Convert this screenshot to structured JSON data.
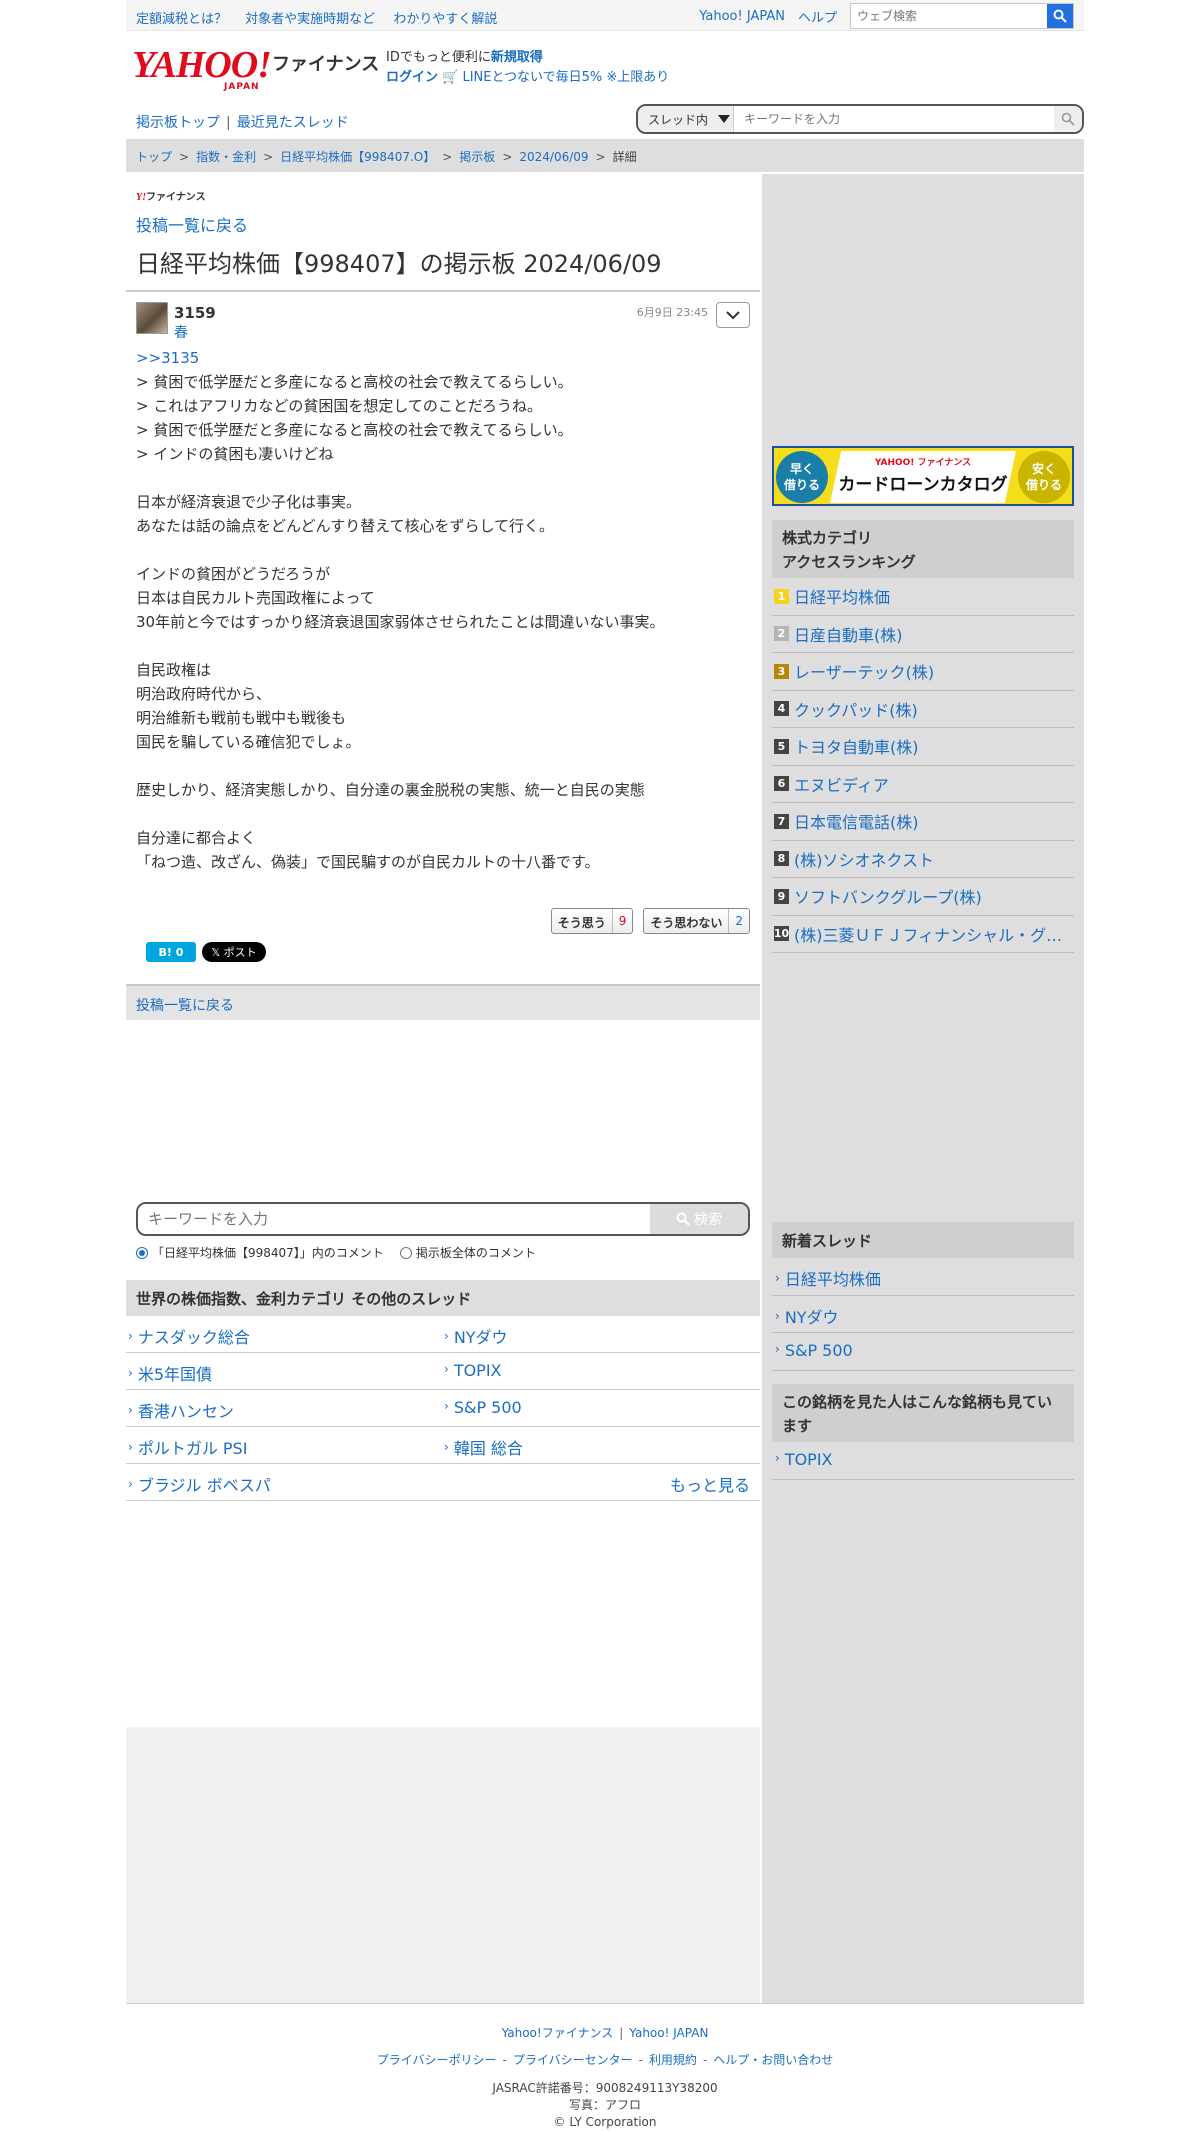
{
  "topbar": {
    "links": [
      "定額減税とは？",
      "対象者や実施時期など",
      "わかりやすく解説"
    ],
    "yahoo_japan": "Yahoo! JAPAN",
    "help": "ヘルプ",
    "web_search_placeholder": "ウェブ検索"
  },
  "header": {
    "logo_text": "YAHOO!",
    "logo_sub": "JAPAN",
    "service_name": "ファイナンス",
    "id_prompt": "IDでもっと便利に",
    "signup": "新規取得",
    "login": "ログイン",
    "line_promo": "LINEとつないで毎日5% ※上限あり"
  },
  "nav": {
    "board_top": "掲示板トップ",
    "recent_threads": "最近見たスレッド",
    "scope_select": "スレッド内",
    "search_placeholder": "キーワードを入力"
  },
  "breadcrumb": [
    "トップ",
    "指数・金利",
    "日経平均株価【998407.O】",
    "掲示板",
    "2024/06/09",
    "詳細"
  ],
  "main": {
    "mini_logo_y": "Y!",
    "mini_logo_text": "ファイナンス",
    "back_label": "投稿一覧に戻る",
    "title": "日経平均株価【998407】の掲示板 2024/06/09",
    "post": {
      "number": "3159",
      "user": "春",
      "date": "6月9日 23:45",
      "reply_link": ">>3135",
      "lines": [
        "> 貧困で低学歴だと多産になると高校の社会で教えてるらしい。",
        "> これはアフリカなどの貧困国を想定してのことだろうね。",
        "> 貧困で低学歴だと多産になると高校の社会で教えてるらしい。",
        "> インドの貧困も凄いけどね",
        "",
        "日本が経済衰退で少子化は事実。",
        "あなたは話の論点をどんどんすり替えて核心をずらして行く。",
        "",
        "インドの貧困がどうだろうが",
        "日本は自民カルト売国政権によって",
        "30年前と今ではすっかり経済衰退国家弱体させられたことは間違いない事実。",
        "",
        "自民政権は",
        "明治政府時代から、",
        "明治維新も戦前も戦中も戦後も",
        "国民を騙している確信犯でしょ。",
        "",
        "歴史しかり、経済実態しかり、自分達の裏金脱税の実態、統一と自民の実態",
        "",
        "自分達に都合よく",
        "「ねつ造、改ざん、偽装」で国民騙すのが自民カルトの十八番です。"
      ],
      "agree_label": "そう思う",
      "agree_count": "9",
      "disagree_label": "そう思わない",
      "disagree_count": "2",
      "hatena_label": "B! 0",
      "x_label": "𝕏 ポスト"
    },
    "back_label_2": "投稿一覧に戻る",
    "keyword_placeholder": "キーワードを入力",
    "search_button": "検索",
    "scope_this": "「日経平均株価【998407】」内のコメント",
    "scope_all": "掲示板全体のコメント",
    "other_threads_title": "世界の株価指数、金利カテゴリ その他のスレッド",
    "other_threads": [
      [
        "ナスダック総合",
        "NYダウ"
      ],
      [
        "米5年国債",
        "TOPIX"
      ],
      [
        "香港ハンセン",
        "S&P 500"
      ],
      [
        "ポルトガル PSI",
        "韓国 総合"
      ],
      [
        "ブラジル ボベスパ",
        ""
      ]
    ],
    "more_label": "もっと見る"
  },
  "side": {
    "ad": {
      "left_badge": "早く\n借りる",
      "brand": "YAHOO! ファイナンス",
      "title": "カードローンカタログ",
      "right_badge": "安く\n借りる"
    },
    "ranking_title_1": "株式カテゴリ",
    "ranking_title_2": "アクセスランキング",
    "ranking": [
      {
        "rank": "1",
        "name": "日経平均株価",
        "color": "#f5d21c"
      },
      {
        "rank": "2",
        "name": "日産自動車(株)",
        "color": "#b5b5b5"
      },
      {
        "rank": "3",
        "name": "レーザーテック(株)",
        "color": "#b8860b"
      },
      {
        "rank": "4",
        "name": "クックパッド(株)",
        "color": "#444444"
      },
      {
        "rank": "5",
        "name": "トヨタ自動車(株)",
        "color": "#444444"
      },
      {
        "rank": "6",
        "name": "エヌビディア",
        "color": "#444444"
      },
      {
        "rank": "7",
        "name": "日本電信電話(株)",
        "color": "#444444"
      },
      {
        "rank": "8",
        "name": "(株)ソシオネクスト",
        "color": "#444444"
      },
      {
        "rank": "9",
        "name": "ソフトバンクグループ(株)",
        "color": "#444444"
      },
      {
        "rank": "10",
        "name": "(株)三菱ＵＦＪフィナンシャル・グ…",
        "color": "#444444"
      }
    ],
    "new_threads_title": "新着スレッド",
    "new_threads": [
      "日経平均株価",
      "NYダウ",
      "S&P 500"
    ],
    "also_viewed_title": "この銘柄を見た人はこんな銘柄も見ています",
    "also_viewed": [
      "TOPIX"
    ]
  },
  "footer": {
    "row1": [
      "Yahoo!ファイナンス",
      "Yahoo! JAPAN"
    ],
    "row2": [
      "プライバシーポリシー",
      "プライバシーセンター",
      "利用規約",
      "ヘルプ・お問い合わせ"
    ],
    "jasrac": "JASRAC許諾番号：9008249113Y38200",
    "photo": "写真：アフロ",
    "copyright": "© LY Corporation"
  }
}
